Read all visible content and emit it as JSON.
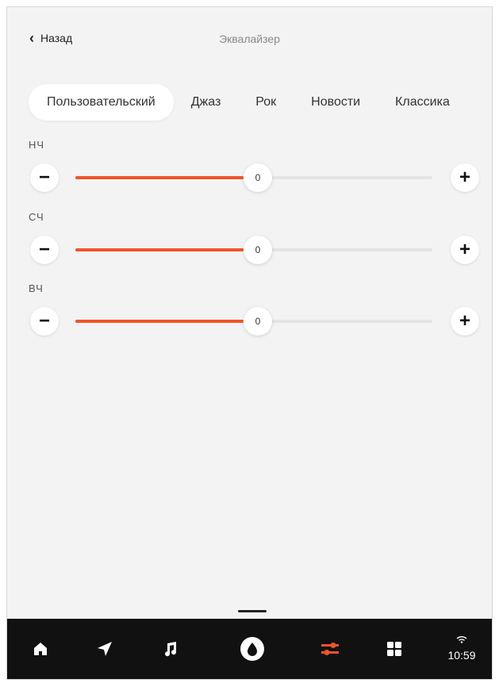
{
  "header": {
    "back_label": "Назад",
    "title": "Эквалайзер"
  },
  "presets": [
    {
      "label": "Пользовательский",
      "active": true
    },
    {
      "label": "Джаз",
      "active": false
    },
    {
      "label": "Рок",
      "active": false
    },
    {
      "label": "Новости",
      "active": false
    },
    {
      "label": "Классика",
      "active": false
    }
  ],
  "bands": [
    {
      "label": "НЧ",
      "value": "0",
      "level": 0.47
    },
    {
      "label": "СЧ",
      "value": "0",
      "level": 0.47
    },
    {
      "label": "ВЧ",
      "value": "0",
      "level": 0.47
    }
  ],
  "colors": {
    "accent": "#f0542a",
    "navbar": "#111111",
    "background": "#f3f3f3"
  },
  "navbar": {
    "items": [
      "home-icon",
      "navigation-icon",
      "music-icon",
      "assistant-icon",
      "equalizer-icon",
      "apps-icon"
    ],
    "active": "equalizer-icon",
    "clock": "10:59"
  }
}
